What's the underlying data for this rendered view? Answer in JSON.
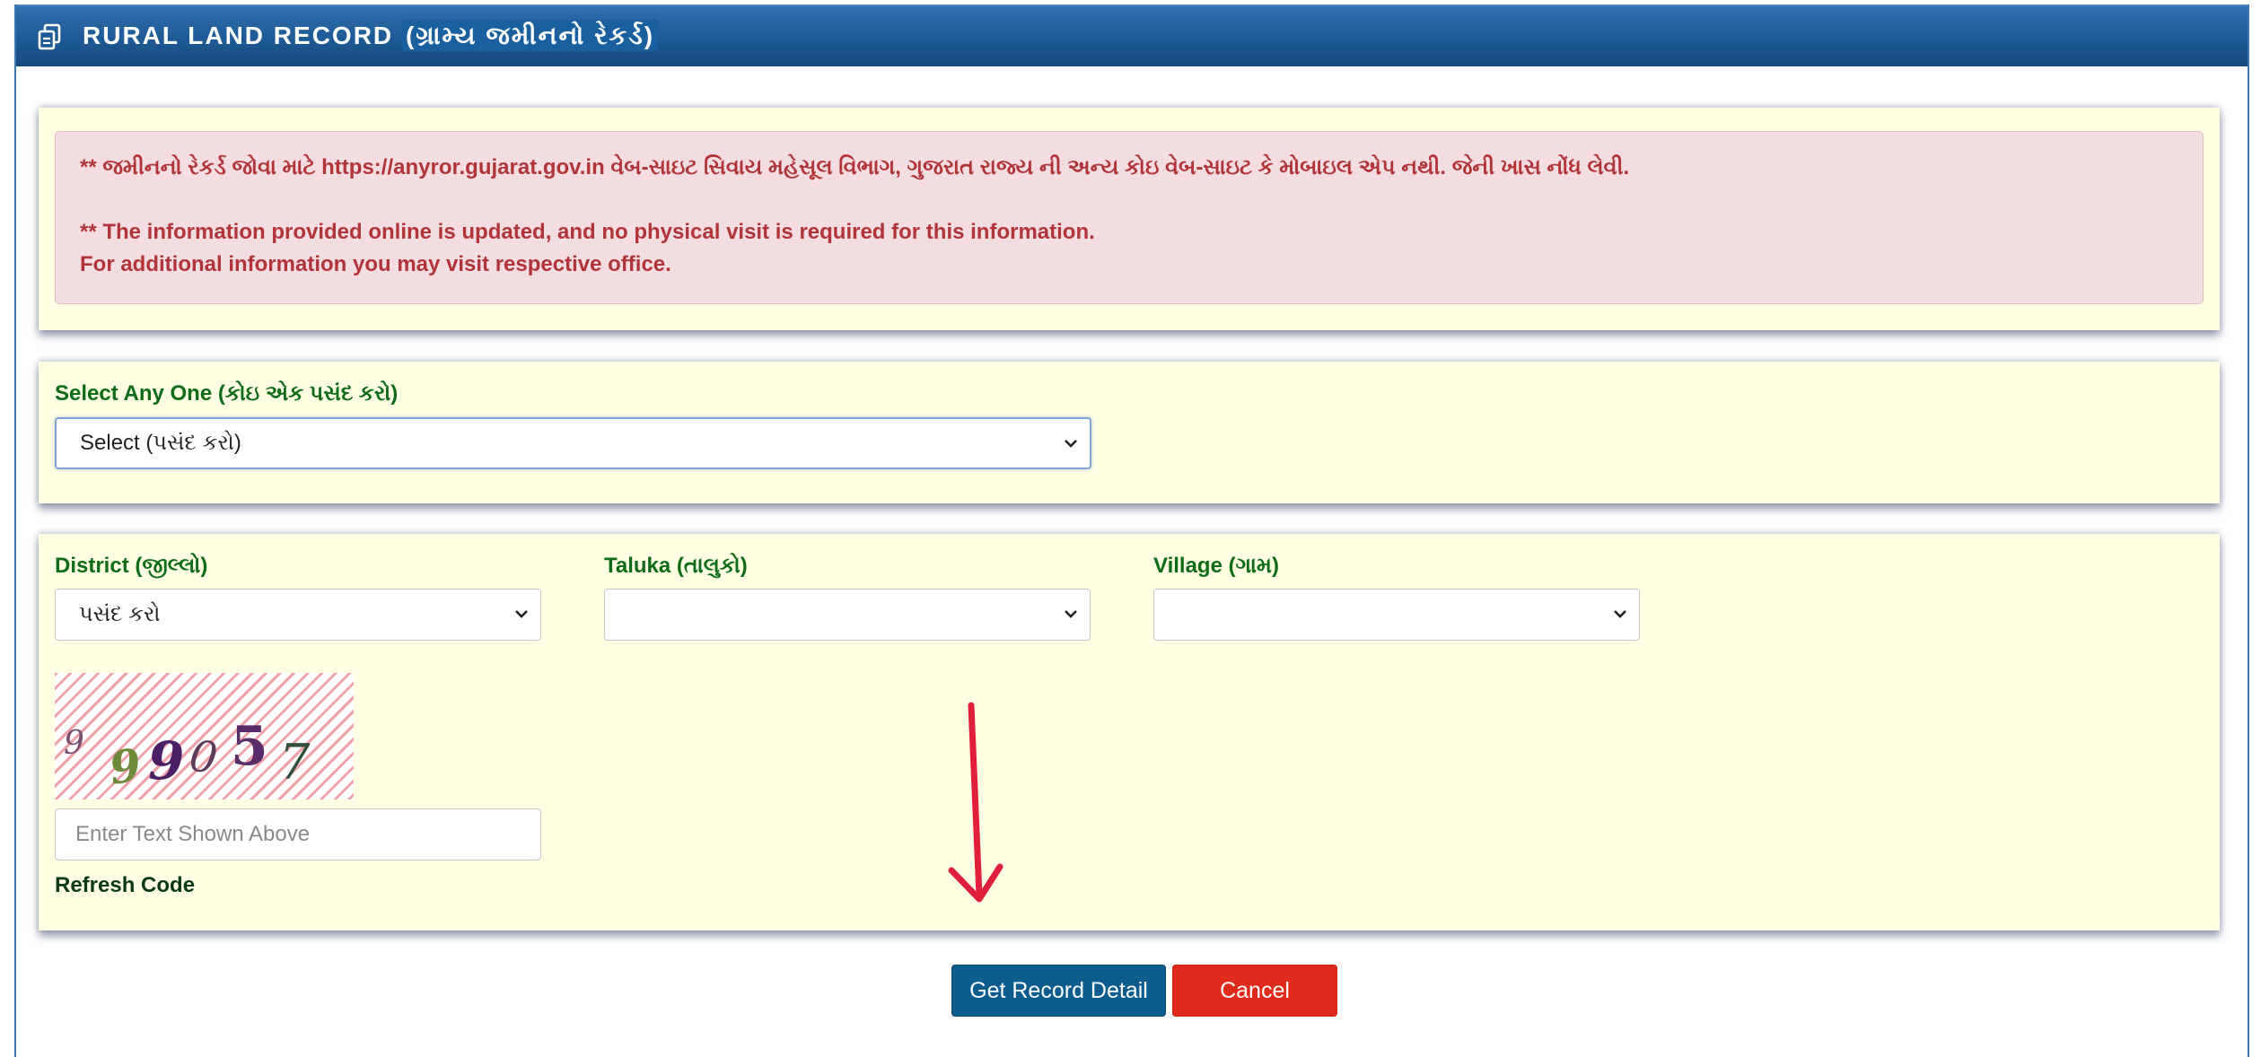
{
  "header": {
    "title_en": "RURAL LAND RECORD",
    "title_gu": "(ગ્રામ્ય જમીનનો રેકર્ડ)",
    "icon": "copy-icon"
  },
  "notice": {
    "line1": "** જમીનનો રેકર્ડ જોવા માટે https://anyror.gujarat.gov.in વેબ-સાઇટ સિવાય મહેસૂલ વિભાગ, ગુજરાત રાજ્ય ની અન્ય કોઇ વેબ-સાઇટ કે મોબાઇલ એપ નથી. જેની ખાસ નોંધ લેવી.",
    "line2": "** The information provided online is updated, and no physical visit is required for this information.",
    "line3": "For additional information you may visit respective office."
  },
  "select_any": {
    "label": "Select Any One (કોઇ એક પસંદ કરો)",
    "value": "Select (પસંદ કરો)"
  },
  "location": {
    "district_label": "District (જીલ્લો)",
    "district_value": "પસંદ કરો",
    "taluka_label": "Taluka (તાલુકો)",
    "taluka_value": "",
    "village_label": "Village (ગામ)",
    "village_value": ""
  },
  "captcha": {
    "digits": [
      "9",
      "9",
      "9",
      "0",
      "5",
      "7"
    ],
    "input_placeholder": "Enter Text Shown Above",
    "refresh_label": "Refresh Code"
  },
  "actions": {
    "submit_label": "Get Record Detail",
    "cancel_label": "Cancel"
  },
  "colors": {
    "header_blue": "#1e5a95",
    "panel_bg": "#ffffe3",
    "label_green": "#0e6b18",
    "alert_red": "#b03438",
    "submit_blue": "#0d5c8e",
    "cancel_red": "#e02a1c",
    "annotation_arrow": "#e0203a"
  }
}
